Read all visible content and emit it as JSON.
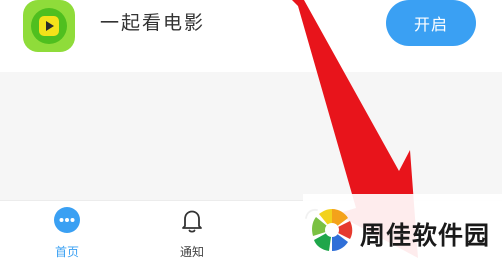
{
  "feature": {
    "icon": "play-icon",
    "title": "一起看电影",
    "button_label": "开启"
  },
  "nav": {
    "items": [
      {
        "label": "首页",
        "icon": "chat-bubble-icon",
        "active": true
      },
      {
        "label": "通知",
        "icon": "bell-icon",
        "active": false
      }
    ]
  },
  "watermark": {
    "text": "周佳软件园"
  },
  "colors": {
    "accent": "#3aa0f3",
    "app_icon": "#8fdc3a",
    "arrow": "#e8141b"
  }
}
